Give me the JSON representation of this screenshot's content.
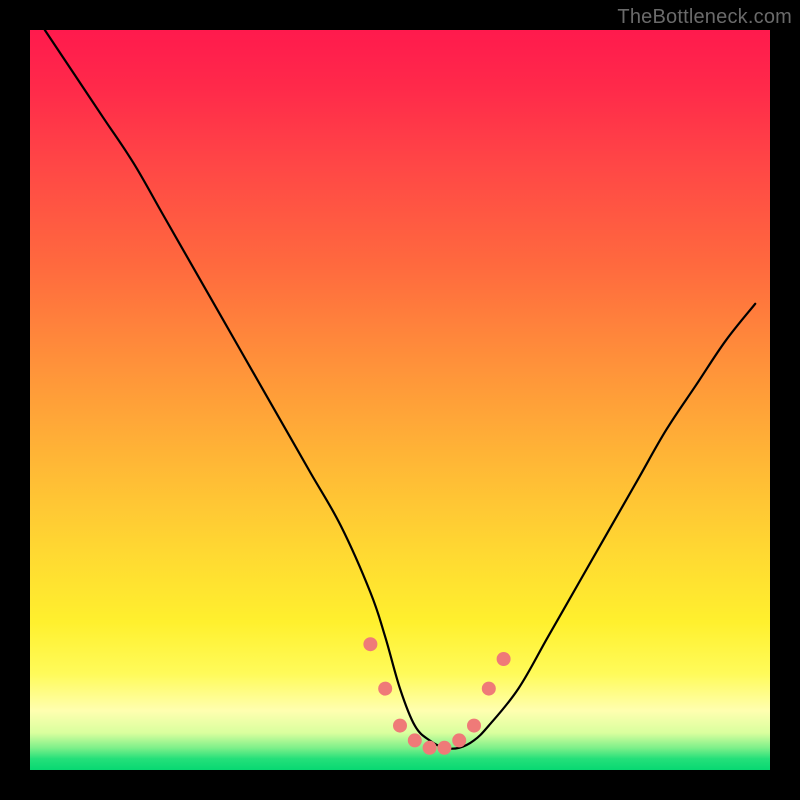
{
  "domain": "Chart",
  "watermark": "TheBottleneck.com",
  "chart_data": {
    "type": "line",
    "title": "",
    "xlabel": "",
    "ylabel": "",
    "xlim": [
      0,
      100
    ],
    "ylim": [
      0,
      100
    ],
    "grid": false,
    "legend": false,
    "curve": {
      "name": "bottleneck-curve",
      "color": "#000000",
      "x": [
        2,
        6,
        10,
        14,
        18,
        22,
        26,
        30,
        34,
        38,
        42,
        46,
        48,
        50,
        52,
        54,
        56,
        58,
        60,
        62,
        66,
        70,
        74,
        78,
        82,
        86,
        90,
        94,
        98
      ],
      "y": [
        100,
        94,
        88,
        82,
        75,
        68,
        61,
        54,
        47,
        40,
        33,
        24,
        18,
        11,
        6,
        4,
        3,
        3,
        4,
        6,
        11,
        18,
        25,
        32,
        39,
        46,
        52,
        58,
        63
      ]
    },
    "markers": {
      "name": "highlight-points",
      "color": "#ef7a78",
      "radius_px": 7,
      "x": [
        46,
        48,
        50,
        52,
        54,
        56,
        58,
        60,
        62,
        64
      ],
      "y": [
        17,
        11,
        6,
        4,
        3,
        3,
        4,
        6,
        11,
        15
      ]
    },
    "background_gradient": {
      "direction": "top-to-bottom",
      "stops": [
        {
          "pos": 0.0,
          "color": "#ff1a4d"
        },
        {
          "pos": 0.45,
          "color": "#ff913a"
        },
        {
          "pos": 0.8,
          "color": "#fff02e"
        },
        {
          "pos": 0.95,
          "color": "#d9ff9e"
        },
        {
          "pos": 1.0,
          "color": "#08d872"
        }
      ]
    }
  }
}
